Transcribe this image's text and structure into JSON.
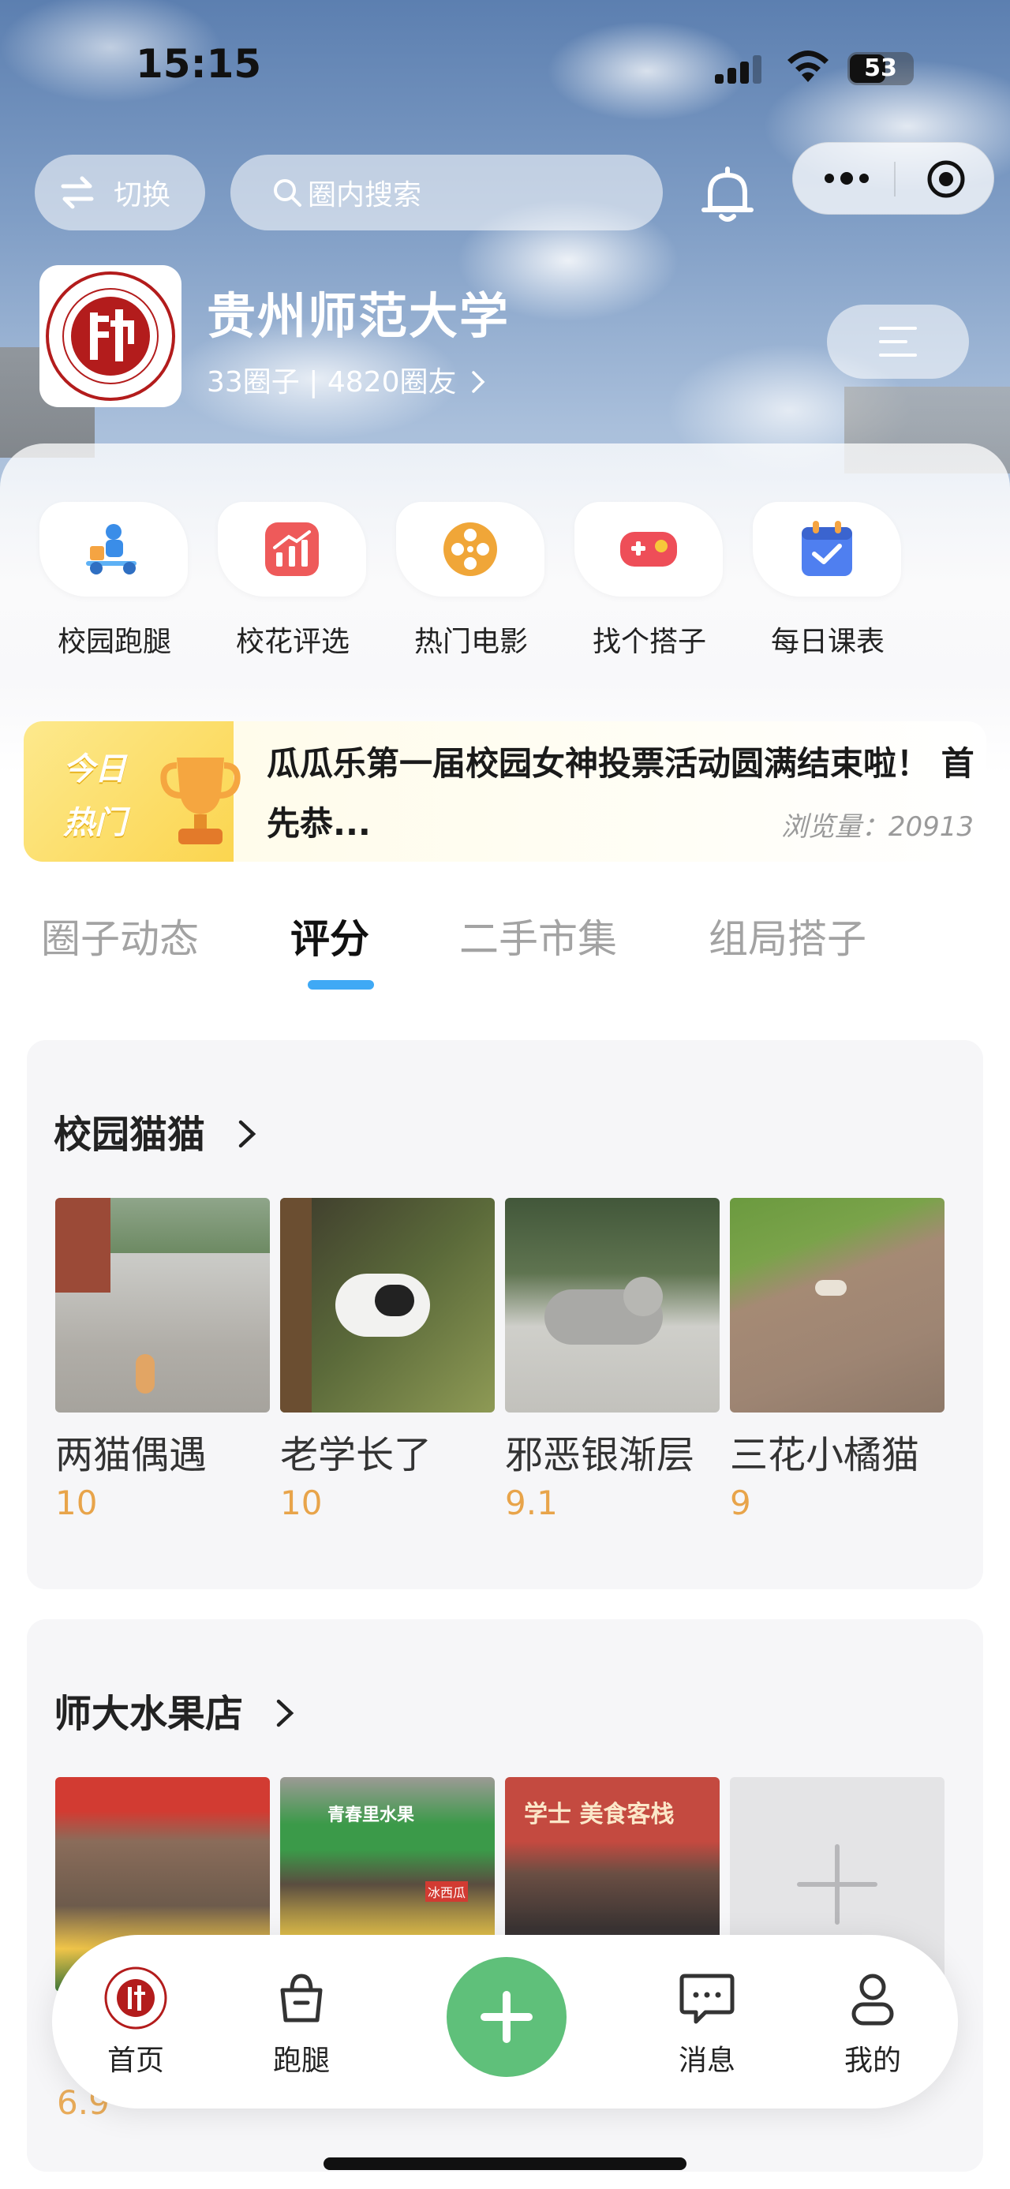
{
  "status_bar": {
    "time": "15:15",
    "battery": "53"
  },
  "top": {
    "switch_label": "切换",
    "search_placeholder": "圈内搜索"
  },
  "community": {
    "name": "贵州师范大学",
    "circles": "33圈子",
    "separator": "|",
    "members": "4820圈友"
  },
  "shortcuts": [
    {
      "label": "校园跑腿",
      "icon": "delivery-rider-icon"
    },
    {
      "label": "校花评选",
      "icon": "chart-icon"
    },
    {
      "label": "热门电影",
      "icon": "film-reel-icon"
    },
    {
      "label": "找个搭子",
      "icon": "gamepad-icon"
    },
    {
      "label": "每日课表",
      "icon": "calendar-check-icon"
    }
  ],
  "hot": {
    "badge_line1": "今日",
    "badge_line2": "热门",
    "text": "瓜瓜乐第一届校园女神投票活动圆满结束啦！ 首先恭...",
    "views": "浏览量：20913"
  },
  "tabs": [
    {
      "label": "圈子动态",
      "active": false
    },
    {
      "label": "评分",
      "active": true
    },
    {
      "label": "二手市集",
      "active": false
    },
    {
      "label": "组局搭子",
      "active": false
    }
  ],
  "sections": [
    {
      "title": "校园猫猫",
      "items": [
        {
          "name": "两猫偶遇",
          "score": "10"
        },
        {
          "name": "老学长了",
          "score": "10"
        },
        {
          "name": "邪恶银渐层",
          "score": "9.1"
        },
        {
          "name": "三花小橘猫",
          "score": "9"
        }
      ]
    },
    {
      "title": "师大水果店",
      "items": [
        {
          "name": "",
          "score": "6.9"
        },
        {
          "name": "",
          "score": ""
        },
        {
          "name": "",
          "score": ""
        }
      ],
      "shop_signs": [
        "青春里水果",
        "学士 美食客栈",
        "冰西瓜"
      ]
    }
  ],
  "bottom_nav": [
    {
      "label": "首页",
      "icon": "school-logo-icon"
    },
    {
      "label": "跑腿",
      "icon": "basket-icon"
    },
    {
      "label": "",
      "icon": "plus-icon"
    },
    {
      "label": "消息",
      "icon": "chat-icon"
    },
    {
      "label": "我的",
      "icon": "user-icon"
    }
  ],
  "colors": {
    "tab_indicator": "#3fa9f5",
    "score": "#e8a44a",
    "fab": "#5fc07a"
  }
}
